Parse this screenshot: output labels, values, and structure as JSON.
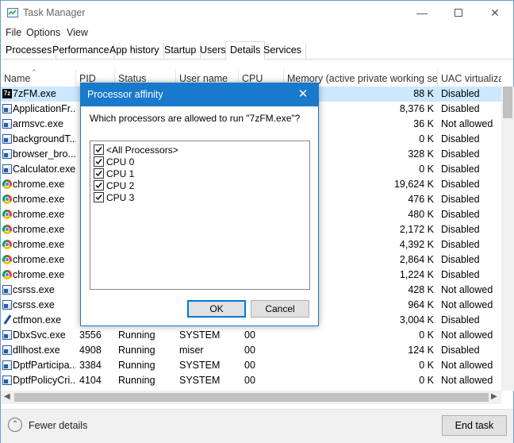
{
  "window": {
    "title": "Task Manager"
  },
  "menu": [
    "File",
    "Options",
    "View"
  ],
  "tabs": [
    {
      "label": "Processes",
      "active": false
    },
    {
      "label": "Performance",
      "active": false
    },
    {
      "label": "App history",
      "active": false
    },
    {
      "label": "Startup",
      "active": false
    },
    {
      "label": "Users",
      "active": false
    },
    {
      "label": "Details",
      "active": true
    },
    {
      "label": "Services",
      "active": false
    }
  ],
  "columns": {
    "name": "Name",
    "pid": "PID",
    "status": "Status",
    "user": "User name",
    "cpu": "CPU",
    "memory": "Memory (active private working set)",
    "uac": "UAC virtualizat"
  },
  "rows": [
    {
      "name": "7zFM.exe",
      "icon": "7zip-icon",
      "pid": "",
      "status": "",
      "user": "",
      "cpu": "",
      "memory": "88 K",
      "uac": "Disabled",
      "selected": true
    },
    {
      "name": "ApplicationFr...",
      "icon": "app-icon",
      "pid": "",
      "status": "",
      "user": "",
      "cpu": "",
      "memory": "8,376 K",
      "uac": "Disabled"
    },
    {
      "name": "armsvc.exe",
      "icon": "app-icon",
      "pid": "",
      "status": "",
      "user": "",
      "cpu": "",
      "memory": "36 K",
      "uac": "Not allowed"
    },
    {
      "name": "backgroundT...",
      "icon": "app-icon",
      "pid": "",
      "status": "",
      "user": "",
      "cpu": "",
      "memory": "0 K",
      "uac": "Disabled"
    },
    {
      "name": "browser_bro...",
      "icon": "app-icon",
      "pid": "",
      "status": "",
      "user": "",
      "cpu": "",
      "memory": "328 K",
      "uac": "Disabled"
    },
    {
      "name": "Calculator.exe",
      "icon": "app-icon",
      "pid": "",
      "status": "",
      "user": "",
      "cpu": "",
      "memory": "0 K",
      "uac": "Disabled"
    },
    {
      "name": "chrome.exe",
      "icon": "chrome-icon",
      "pid": "",
      "status": "",
      "user": "",
      "cpu": "",
      "memory": "19,624 K",
      "uac": "Disabled"
    },
    {
      "name": "chrome.exe",
      "icon": "chrome-icon",
      "pid": "",
      "status": "",
      "user": "",
      "cpu": "",
      "memory": "476 K",
      "uac": "Disabled"
    },
    {
      "name": "chrome.exe",
      "icon": "chrome-icon",
      "pid": "",
      "status": "",
      "user": "",
      "cpu": "",
      "memory": "480 K",
      "uac": "Disabled"
    },
    {
      "name": "chrome.exe",
      "icon": "chrome-icon",
      "pid": "",
      "status": "",
      "user": "",
      "cpu": "",
      "memory": "2,172 K",
      "uac": "Disabled"
    },
    {
      "name": "chrome.exe",
      "icon": "chrome-icon",
      "pid": "",
      "status": "",
      "user": "",
      "cpu": "",
      "memory": "4,392 K",
      "uac": "Disabled"
    },
    {
      "name": "chrome.exe",
      "icon": "chrome-icon",
      "pid": "",
      "status": "",
      "user": "",
      "cpu": "",
      "memory": "2,864 K",
      "uac": "Disabled"
    },
    {
      "name": "chrome.exe",
      "icon": "chrome-icon",
      "pid": "",
      "status": "",
      "user": "",
      "cpu": "",
      "memory": "1,224 K",
      "uac": "Disabled"
    },
    {
      "name": "csrss.exe",
      "icon": "app-icon",
      "pid": "",
      "status": "",
      "user": "",
      "cpu": "",
      "memory": "428 K",
      "uac": "Not allowed"
    },
    {
      "name": "csrss.exe",
      "icon": "app-icon",
      "pid": "",
      "status": "",
      "user": "",
      "cpu": "",
      "memory": "964 K",
      "uac": "Not allowed"
    },
    {
      "name": "ctfmon.exe",
      "icon": "pen-icon",
      "pid": "",
      "status": "",
      "user": "",
      "cpu": "",
      "memory": "3,004 K",
      "uac": "Disabled"
    },
    {
      "name": "DbxSvc.exe",
      "icon": "app-icon",
      "pid": "3556",
      "status": "Running",
      "user": "SYSTEM",
      "cpu": "00",
      "memory": "0 K",
      "uac": "Not allowed"
    },
    {
      "name": "dllhost.exe",
      "icon": "app-icon",
      "pid": "4908",
      "status": "Running",
      "user": "miser",
      "cpu": "00",
      "memory": "124 K",
      "uac": "Disabled"
    },
    {
      "name": "DptfParticipa...",
      "icon": "app-icon",
      "pid": "3384",
      "status": "Running",
      "user": "SYSTEM",
      "cpu": "00",
      "memory": "0 K",
      "uac": "Not allowed"
    },
    {
      "name": "DptfPolicyCri...",
      "icon": "app-icon",
      "pid": "4104",
      "status": "Running",
      "user": "SYSTEM",
      "cpu": "00",
      "memory": "0 K",
      "uac": "Not allowed"
    }
  ],
  "dialog": {
    "title": "Processor affinity",
    "question": "Which processors are allowed to run \"7zFM.exe\"?",
    "processors": [
      {
        "label": "<All Processors>",
        "checked": true
      },
      {
        "label": "CPU 0",
        "checked": true
      },
      {
        "label": "CPU 1",
        "checked": true
      },
      {
        "label": "CPU 2",
        "checked": true
      },
      {
        "label": "CPU 3",
        "checked": true
      }
    ],
    "ok_label": "OK",
    "cancel_label": "Cancel"
  },
  "footer": {
    "fewer_details": "Fewer details",
    "end_task": "End task"
  },
  "colors": {
    "dialog_accent": "#1979ca",
    "selection": "#cce8ff",
    "default_button_border": "#0078d7"
  }
}
